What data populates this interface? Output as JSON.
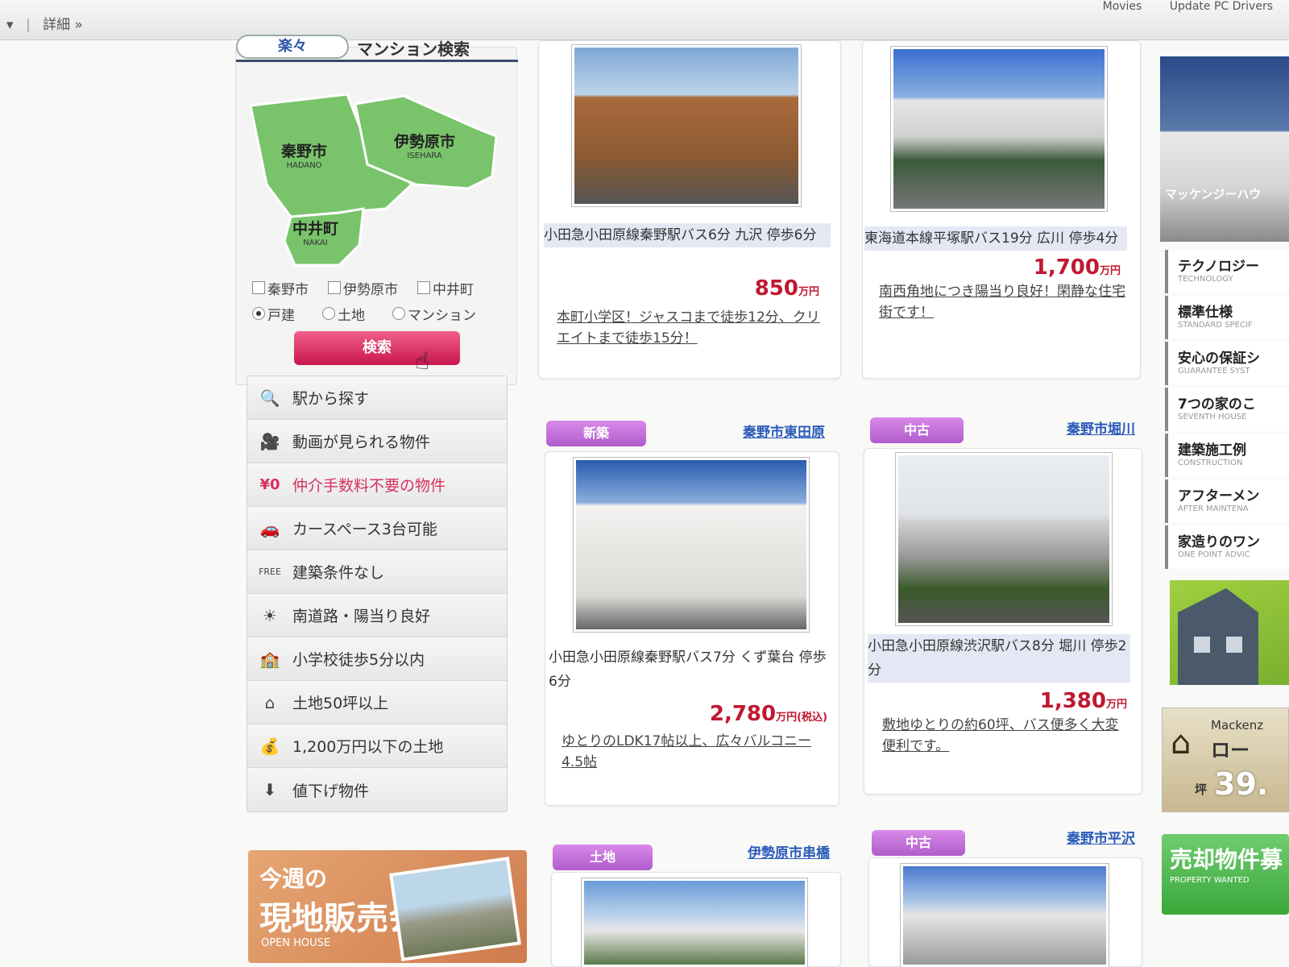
{
  "topbar": {
    "left_dropdown": "▾",
    "details": "詳細 »",
    "right_items": [
      "Movies",
      "Update PC Drivers"
    ]
  },
  "search": {
    "header_bubble": "楽々",
    "header_title": "マンション検索",
    "areas": [
      {
        "jp": "秦野市",
        "en": "HADANO"
      },
      {
        "jp": "伊勢原市",
        "en": "ISEHARA"
      },
      {
        "jp": "中井町",
        "en": "NAKAI"
      }
    ],
    "checkboxes": [
      {
        "label": "秦野市",
        "checked": false
      },
      {
        "label": "伊勢原市",
        "checked": false
      },
      {
        "label": "中井町",
        "checked": false
      }
    ],
    "radios": [
      {
        "label": "戸建",
        "selected": true
      },
      {
        "label": "土地",
        "selected": false
      },
      {
        "label": "マンション",
        "selected": false
      }
    ],
    "button_label": "検索",
    "map_colors": {
      "fill": "#79c46b",
      "border": "#ffffff"
    }
  },
  "menu": [
    {
      "icon": "🔍",
      "icon_name": "search-icon",
      "label": "駅から探す"
    },
    {
      "icon": "🎥",
      "icon_name": "video-camera-icon",
      "label": "動画が見られる物件"
    },
    {
      "icon": "¥0",
      "icon_name": "yen-zero-icon",
      "label": "仲介手数料不要の物件",
      "accent": true
    },
    {
      "icon": "🚗",
      "icon_name": "car-icon",
      "label": "カースペース3台可能"
    },
    {
      "icon": "FREE",
      "icon_name": "free-icon",
      "label": "建築条件なし"
    },
    {
      "icon": "☀",
      "icon_name": "sun-icon",
      "label": "南道路・陽当り良好"
    },
    {
      "icon": "🏫",
      "icon_name": "school-icon",
      "label": "小学校徒歩5分以内"
    },
    {
      "icon": "⌂",
      "icon_name": "house-icon",
      "label": "土地50坪以上"
    },
    {
      "icon": "💰",
      "icon_name": "money-icon",
      "label": "1,200万円以下の土地"
    },
    {
      "icon": "⬇",
      "icon_name": "down-arrow-icon",
      "label": "値下げ物件"
    }
  ],
  "openhouse": {
    "line1": "今週の",
    "line2": "現地販売会",
    "line3": "OPEN HOUSE"
  },
  "listings": [
    {
      "title": "小田急小田原線秦野駅バス6分 九沢 停歩6分",
      "price": "850",
      "unit": "万円",
      "desc": "本町小学区！ジャスコまで徒歩12分、クリエイトまで徒歩15分！"
    },
    {
      "title": "東海道本線平塚駅バス19分 広川 停歩4分",
      "price": "1,700",
      "unit": "万円",
      "desc": "南西角地につき陽当り良好！閑静な住宅街です！"
    },
    {
      "badge": "新築",
      "location": "秦野市東田原",
      "title": "小田急小田原線秦野駅バス7分 くず葉台 停歩6分",
      "price": "2,780",
      "unit": "万円(税込)",
      "desc": "ゆとりのLDK17帖以上、広々バルコニー4.5帖"
    },
    {
      "badge": "中古",
      "location": "秦野市堀川",
      "title": "小田急小田原線渋沢駅バス8分 堀川 停歩2分",
      "price": "1,380",
      "unit": "万円",
      "desc": "敷地ゆとりの約60坪、バス便多く大変便利です。"
    },
    {
      "badge": "土地",
      "location": "伊勢原市串橋"
    },
    {
      "badge": "中古",
      "location": "秦野市平沢"
    }
  ],
  "rightcol": {
    "hero_text": "マッケンジーハウ",
    "menu": [
      {
        "jp": "テクノロジー",
        "en": "TECHNOLOGY"
      },
      {
        "jp": "標準仕様",
        "en": "STANDARD SPECIF"
      },
      {
        "jp": "安心の保証シ",
        "en": "GUARANTEE SYST"
      },
      {
        "jp": "7つの家のこ",
        "en": "SEVENTH HOUSE"
      },
      {
        "jp": "建築施工例",
        "en": "CONSTRUCTION"
      },
      {
        "jp": "アフターメン",
        "en": "AFTER MAINTENA"
      },
      {
        "jp": "家造りのワン",
        "en": "ONE POINT ADVIC"
      }
    ],
    "loan": {
      "brand": "Mackenz",
      "title": "ロー",
      "tsubo": "坪",
      "number": "39."
    },
    "sell": {
      "jp": "売却物件募",
      "en": "PROPERTY WANTED"
    }
  },
  "colors": {
    "accent_pink": "#d83060",
    "price_red": "#c01830",
    "badge_purple": "#b05ccc",
    "link_blue": "#2a5ab8",
    "map_green": "#79c46b"
  }
}
